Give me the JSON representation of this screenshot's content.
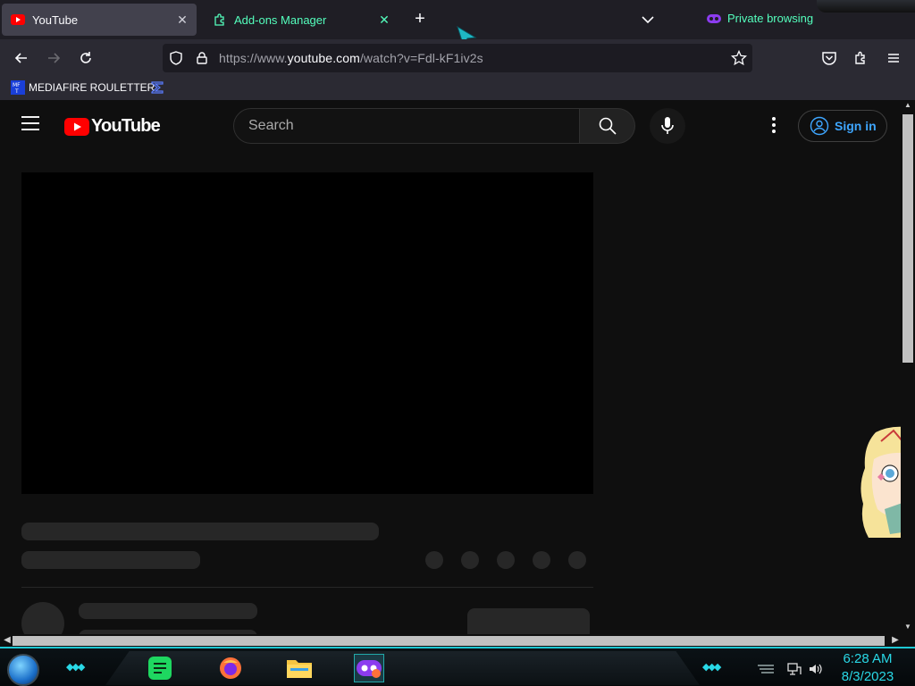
{
  "browser": {
    "tabs": [
      {
        "label": "YouTube",
        "active": true
      },
      {
        "label": "Add-ons Manager",
        "active": false
      }
    ],
    "private_label": "Private browsing",
    "url_prefix": "https://www.",
    "url_domain": "youtube.com",
    "url_path": "/watch?v=Fdl-kF1iv2s",
    "bookmarks": [
      {
        "label": "MEDIAFIRE ROULETTER",
        "icon": "mf-icon"
      },
      {
        "label": "",
        "icon": "folder-sigma-icon"
      }
    ]
  },
  "youtube": {
    "logo_text": "YouTube",
    "search_placeholder": "Search",
    "signin_label": "Sign in"
  },
  "taskbar": {
    "time": "6:28 AM",
    "date": "8/3/2023",
    "apps": [
      "notes-app-icon",
      "firefox-icon",
      "file-explorer-icon",
      "private-browser-icon"
    ]
  },
  "colors": {
    "private_accent": "#54ffbd",
    "youtube_red": "#ff0000",
    "signin_blue": "#3ea6ff",
    "taskbar_accent": "#29d8e6"
  }
}
